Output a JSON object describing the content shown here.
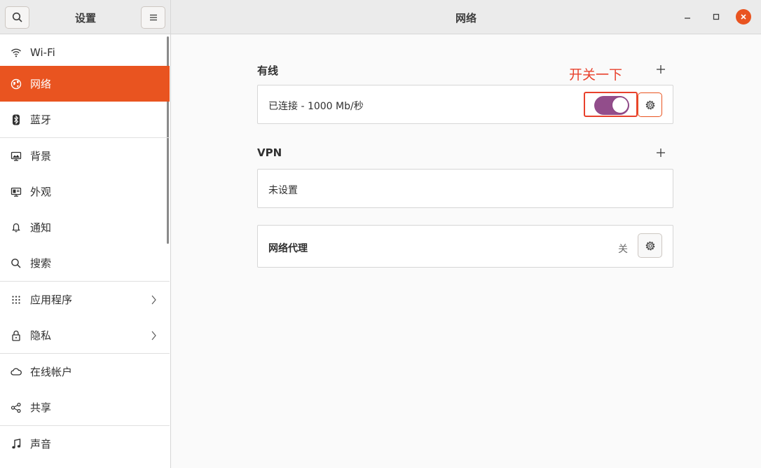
{
  "titlebar": {
    "left_title": "设置",
    "main_title": "网络"
  },
  "sidebar": {
    "items": [
      {
        "label": "Wi-Fi",
        "icon": "wifi-icon"
      },
      {
        "label": "网络",
        "icon": "network-icon",
        "active": true
      },
      {
        "label": "蓝牙",
        "icon": "bluetooth-icon"
      },
      {
        "label": "背景",
        "icon": "background-icon"
      },
      {
        "label": "外观",
        "icon": "appearance-icon"
      },
      {
        "label": "通知",
        "icon": "bell-icon"
      },
      {
        "label": "搜索",
        "icon": "search-icon"
      },
      {
        "label": "应用程序",
        "icon": "apps-grid-icon",
        "has_submenu": true
      },
      {
        "label": "隐私",
        "icon": "lock-icon",
        "has_submenu": true
      },
      {
        "label": "在线帐户",
        "icon": "cloud-icon"
      },
      {
        "label": "共享",
        "icon": "share-icon"
      },
      {
        "label": "声音",
        "icon": "music-note-icon"
      }
    ]
  },
  "main": {
    "wired": {
      "title": "有线",
      "status": "已连接 - 1000 Mb/秒",
      "toggle_on": true
    },
    "vpn": {
      "title": "VPN",
      "status": "未设置"
    },
    "proxy": {
      "title": "网络代理",
      "status": "关"
    },
    "annotation": "开关一下"
  },
  "colors": {
    "accent": "#e95420",
    "toggle": "#924d8b",
    "annotation": "#e8412c"
  }
}
